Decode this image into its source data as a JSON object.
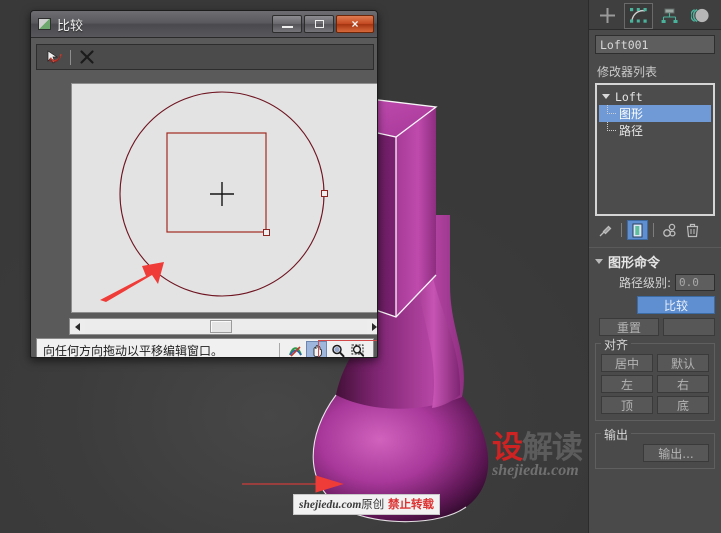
{
  "viewport": {
    "name": "perspective-viewport",
    "object_color": "#a6379a",
    "background": "#3e3e3e"
  },
  "watermark": {
    "logo_red": "设",
    "logo_gray": "解读",
    "domain": "shejiedu.com",
    "tooltip_domain": "shejiedu.com",
    "tooltip_cn": "原创",
    "tooltip_warn": "禁止转载"
  },
  "dialog": {
    "title": "比较",
    "icon": "compare-window-icon",
    "buttons": {
      "minimize": "minimize-icon",
      "maximize": "maximize-icon",
      "close": "×"
    },
    "toolbar": {
      "pick_shape": "pick-shape-icon",
      "delete_shape": "delete-shape-icon"
    },
    "status_text": "向任何方向拖动以平移编辑窗口。",
    "status_buttons": [
      {
        "name": "reset-view-icon",
        "label": "reset",
        "selected": false
      },
      {
        "name": "pan-hand-icon",
        "label": "pan",
        "selected": true
      },
      {
        "name": "zoom-magnifier-icon",
        "label": "zoom",
        "selected": false
      },
      {
        "name": "zoom-region-icon",
        "label": "zoom-region",
        "selected": false
      }
    ],
    "shapes": {
      "circle_color": "#7a1422",
      "rect_color": "#c0392b",
      "crosshair_color": "#1a1a1a"
    }
  },
  "panel": {
    "tabs": [
      {
        "name": "create-tab",
        "icon": "plus-icon",
        "active": false
      },
      {
        "name": "modify-tab",
        "icon": "modify-curve-icon",
        "active": true
      },
      {
        "name": "hierarchy-tab",
        "icon": "hierarchy-icon",
        "active": false
      },
      {
        "name": "motion-tab",
        "icon": "motion-icon",
        "active": false
      }
    ],
    "object_name": "Loft001",
    "modifier_list_label": "修改器列表",
    "stack": {
      "root": "Loft",
      "children": [
        {
          "label": "图形",
          "selected": true
        },
        {
          "label": "路径",
          "selected": false
        }
      ]
    },
    "stack_tools": [
      {
        "name": "pin-stack-icon",
        "on": false
      },
      {
        "name": "show-end-result-icon",
        "on": true
      },
      {
        "name": "make-unique-icon",
        "on": false
      },
      {
        "name": "delete-modifier-icon",
        "on": false
      }
    ],
    "rollout": {
      "title": "图形命令",
      "path_level_label": "路径级别:",
      "path_level_value": "0.0",
      "compare_button": "比较",
      "reset_button": "重置",
      "align_group": "对齐",
      "align_buttons": [
        "居中",
        "默认",
        "左",
        "右",
        "顶",
        "底"
      ],
      "output_group": "输出",
      "output_button": "输出..."
    }
  }
}
